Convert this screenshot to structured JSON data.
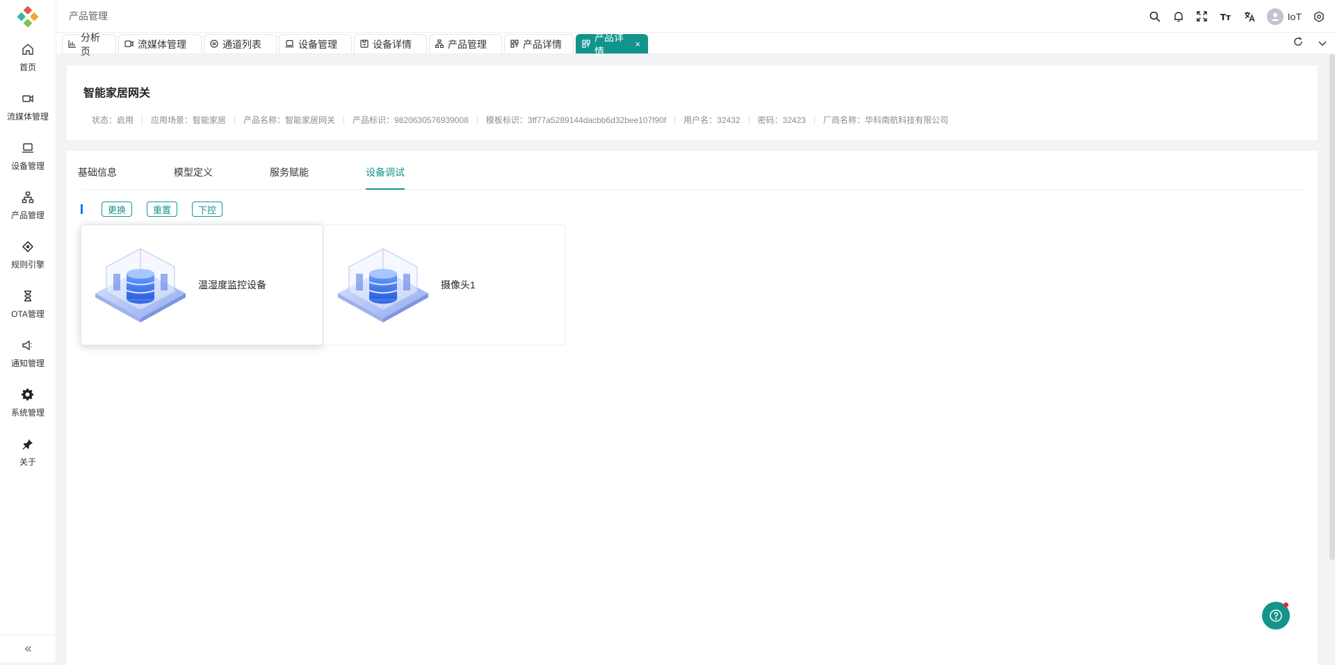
{
  "sidebar": {
    "items": [
      {
        "label": "首页",
        "icon": "home-icon"
      },
      {
        "label": "流媒体管理",
        "icon": "video-icon"
      },
      {
        "label": "设备管理",
        "icon": "laptop-icon"
      },
      {
        "label": "产品管理",
        "icon": "hierarchy-icon"
      },
      {
        "label": "规则引擎",
        "icon": "diamond-icon"
      },
      {
        "label": "OTA管理",
        "icon": "hourglass-icon"
      },
      {
        "label": "通知管理",
        "icon": "megaphone-icon"
      },
      {
        "label": "系统管理",
        "icon": "gear-icon"
      },
      {
        "label": "关于",
        "icon": "pin-icon"
      }
    ],
    "collapse": "«"
  },
  "header": {
    "breadcrumb": "产品管理",
    "user": "IoT"
  },
  "tabs": [
    {
      "label": "分析页",
      "icon": "bar-chart-icon"
    },
    {
      "label": "流媒体管理",
      "icon": "video-icon"
    },
    {
      "label": "通道列表",
      "icon": "channel-icon"
    },
    {
      "label": "设备管理",
      "icon": "laptop-icon"
    },
    {
      "label": "设备详情",
      "icon": "detail-icon"
    },
    {
      "label": "产品管理",
      "icon": "hierarchy-icon"
    },
    {
      "label": "产品详情",
      "icon": "grid-icon"
    },
    {
      "label": "产品详情",
      "icon": "grid-icon",
      "active": true
    }
  ],
  "product": {
    "title": "智能家居网关",
    "meta": [
      "状态：启用",
      "应用场景：智能家居",
      "产品名称：智能家居网关",
      "产品标识：9820630576939008",
      "模板标识：3ff77a5289144dacbb6d32bee107f90f",
      "用户名：32432",
      "密码：32423",
      "厂商名称：华科南航科技有限公司"
    ]
  },
  "detail_tabs": [
    "基础信息",
    "模型定义",
    "服务赋能",
    "设备调试"
  ],
  "active_detail_tab": "设备调试",
  "actions": [
    "更换",
    "重置",
    "下控"
  ],
  "devices": [
    {
      "name": "温湿度监控设备",
      "selected": true
    },
    {
      "name": "摄像头1",
      "selected": false
    }
  ],
  "colors": {
    "primary": "#13948b",
    "accent": "#1677ff"
  }
}
